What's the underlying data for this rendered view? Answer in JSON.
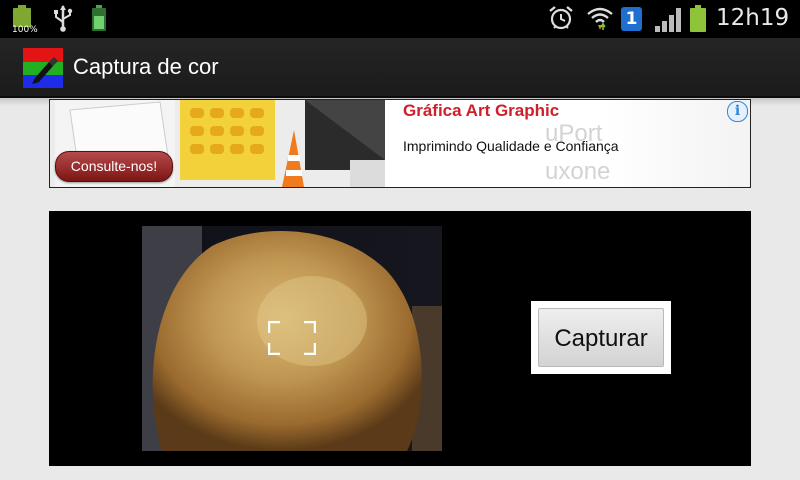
{
  "status_bar": {
    "battery_percent": "100%",
    "clock": "12h19",
    "notification_count": "1",
    "icons": [
      "battery-icon",
      "usb-icon",
      "battery-charging-icon",
      "alarm-icon",
      "wifi-icon",
      "notification-icon",
      "signal-icon",
      "battery-icon"
    ]
  },
  "action_bar": {
    "title": "Captura de cor",
    "app_icon": "color-picker-icon"
  },
  "ad": {
    "title": "Gráfica Art Graphic",
    "subtitle": "Imprimindo Qualidade e Confiança",
    "button_label": "Consulte-nos!",
    "info_icon": "i"
  },
  "capture": {
    "button_label": "Capturar",
    "focus_icon": "focus-frame-icon"
  },
  "colors": {
    "accent_red": "#cf1f2a",
    "info_blue": "#2e86d6",
    "notif_blue": "#1f6fd1"
  }
}
